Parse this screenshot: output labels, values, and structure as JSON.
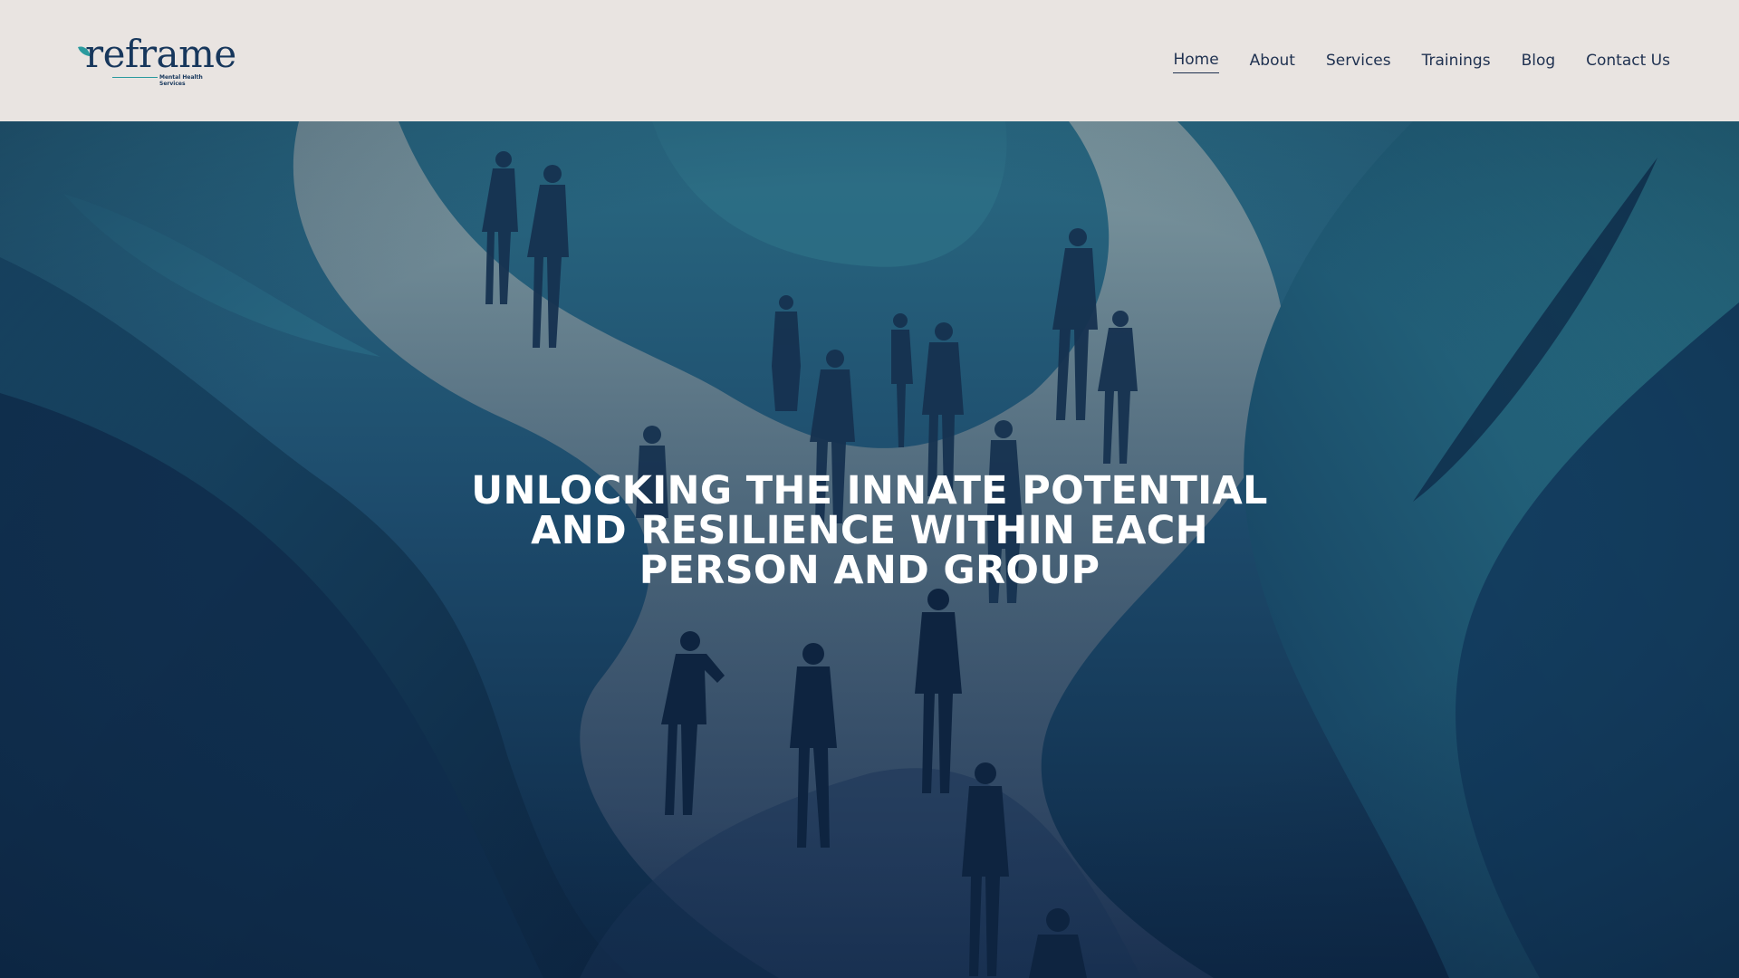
{
  "brand": {
    "name": "reframe",
    "tagline": "Mental Health Services",
    "colors": {
      "navy": "#17375c",
      "teal": "#2a9a9e",
      "header_bg": "#e9e4e1"
    }
  },
  "nav": {
    "items": [
      {
        "label": "Home",
        "active": true
      },
      {
        "label": "About",
        "active": false
      },
      {
        "label": "Services",
        "active": false
      },
      {
        "label": "Trainings",
        "active": false
      },
      {
        "label": "Blog",
        "active": false
      },
      {
        "label": "Contact Us",
        "active": false
      }
    ]
  },
  "hero": {
    "headline_lines": [
      "UNLOCKING THE INNATE POTENTIAL",
      "AND RESILIENCE WITHIN EACH",
      "PERSON AND GROUP"
    ],
    "image_description_icon": "people-walking-winding-path-illustration"
  }
}
